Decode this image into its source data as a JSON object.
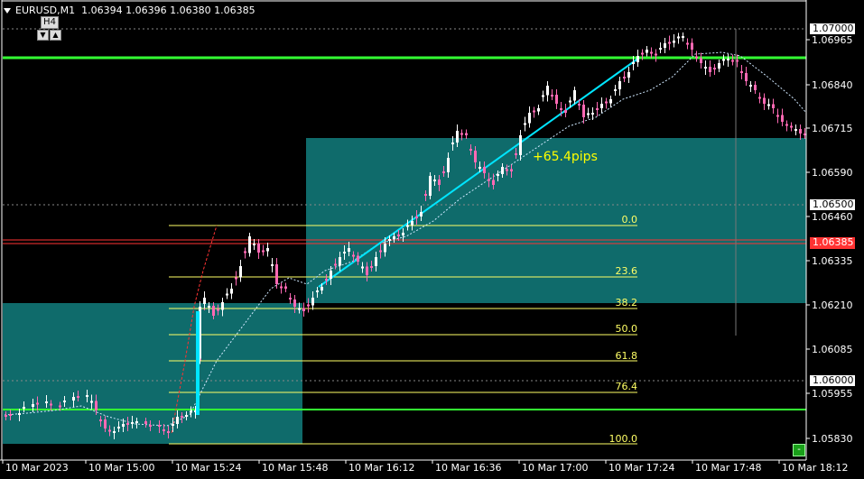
{
  "header": {
    "symbol": "EURUSD,M1",
    "ohlc": "1.06394 1.06396 1.06380 1.06385"
  },
  "timeframe_panel": {
    "label": "H4",
    "down_icon": "triangle-down-icon",
    "up_icon": "triangle-up-icon"
  },
  "annotation": {
    "pips_text": "+65.4pips"
  },
  "fibonacci_levels": [
    "0.0",
    "23.6",
    "38.2",
    "50.0",
    "61.8",
    "76.4",
    "100.0"
  ],
  "price_axis": {
    "labels": [
      "1.06965",
      "1.06840",
      "1.06715",
      "1.06590",
      "1.06460",
      "1.06335",
      "1.06210",
      "1.06085",
      "1.05955",
      "1.05830"
    ],
    "boxed_labels": [
      "1.07000",
      "1.06500",
      "1.06000"
    ],
    "current_price": "1.06385"
  },
  "time_axis": {
    "labels": [
      "10 Mar 2023",
      "10 Mar 15:00",
      "10 Mar 15:24",
      "10 Mar 15:48",
      "10 Mar 16:12",
      "10 Mar 16:36",
      "10 Mar 17:00",
      "10 Mar 17:24",
      "10 Mar 17:48",
      "10 Mar 18:12"
    ]
  },
  "corner_button": {
    "label": "-"
  },
  "colors": {
    "background": "#000000",
    "bull_candle": "#ffffff",
    "bear_candle": "#ff69b4",
    "teal_zone": "#0f6b6b",
    "green_line": "#33ff33",
    "trend_line": "#00e5ff",
    "fib_line": "#ffff66",
    "current_price": "#ff3333"
  }
}
